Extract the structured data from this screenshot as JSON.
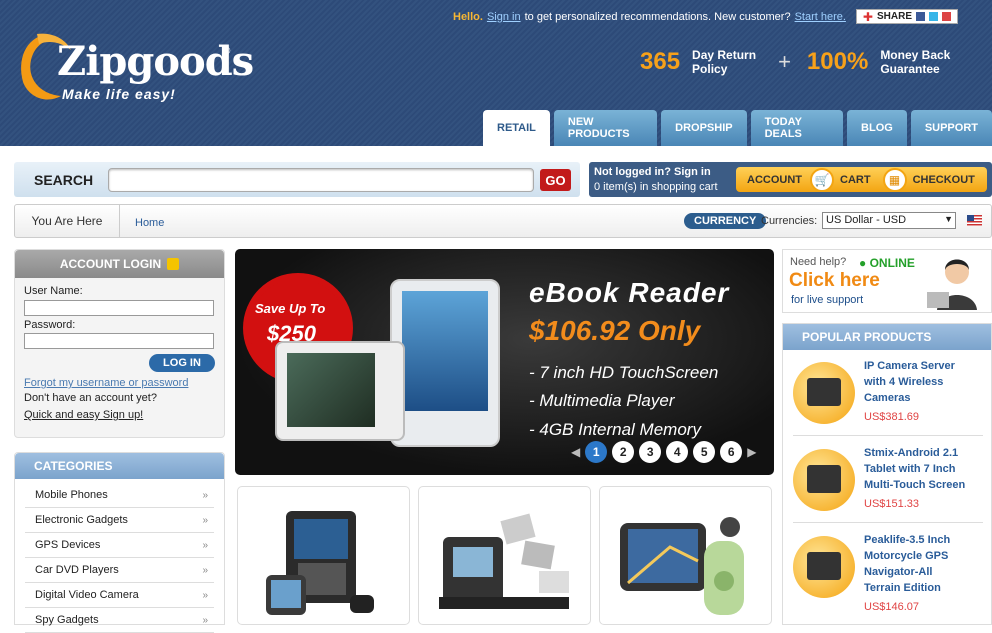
{
  "topbar": {
    "hello": "Hello.",
    "signin": "Sign in",
    "text": "to get personalized recommendations. New customer?",
    "start": "Start here.",
    "share": "SHARE"
  },
  "logo": {
    "name": "Zipgoods",
    "reg": "®",
    "tagline": "Make life easy!"
  },
  "promo": {
    "days": "365",
    "days_text_1": "Day Return",
    "days_text_2": "Policy",
    "plus": "+",
    "pct": "100%",
    "pct_text_1": "Money Back",
    "pct_text_2": "Guarantee"
  },
  "tabs": [
    "RETAIL",
    "NEW PRODUCTS",
    "DROPSHIP",
    "TODAY DEALS",
    "BLOG",
    "SUPPORT"
  ],
  "search": {
    "label": "SEARCH",
    "value": "",
    "go": "GO"
  },
  "account": {
    "status": "Not logged in? Sign in",
    "cart_count": "0 item(s) in shopping cart",
    "account": "ACCOUNT",
    "cart": "CART",
    "checkout": "CHECKOUT"
  },
  "breadcrumb": {
    "you_are_here": "You Are Here",
    "home": "Home",
    "currency_badge": "CURRENCY",
    "currency_label": "Currencies:",
    "currency_value": "US Dollar - USD"
  },
  "login": {
    "title": "ACCOUNT LOGIN",
    "username_label": "User Name:",
    "password_label": "Password:",
    "button": "LOG IN",
    "forgot": "Forgot my username or password",
    "no_account": "Don't have an account yet?",
    "signup": "Quick and easy Sign up!"
  },
  "categories": {
    "title": "CATEGORIES",
    "items": [
      "Mobile Phones",
      "Electronic Gadgets",
      "GPS Devices",
      "Car DVD Players",
      "Digital Video Camera",
      "Spy Gadgets"
    ]
  },
  "banner": {
    "save_line1": "Save Up To",
    "save_line2": "$250",
    "title": "eBook Reader",
    "price": "$106.92 Only",
    "features": [
      "- 7 inch HD TouchScreen",
      "- Multimedia Player",
      "- 4GB Internal Memory"
    ],
    "pages": [
      "1",
      "2",
      "3",
      "4",
      "5",
      "6"
    ],
    "active_page": "1"
  },
  "help": {
    "need": "Need help?",
    "online": "ONLINE",
    "click": "Click here",
    "for_live": "for live support"
  },
  "popular": {
    "title": "POPULAR PRODUCTS",
    "items": [
      {
        "name_1": "IP Camera Server",
        "name_2": "with 4 Wireless",
        "name_3": "Cameras",
        "name_4": "",
        "price": "US$381.69"
      },
      {
        "name_1": "Stmix-Android 2.1",
        "name_2": "Tablet with 7 Inch",
        "name_3": "Multi-Touch Screen",
        "name_4": "",
        "price": "US$151.33"
      },
      {
        "name_1": "Peaklife-3.5 Inch",
        "name_2": "Motorcycle GPS",
        "name_3": "Navigator-All",
        "name_4": "Terrain Edition",
        "price": "US$146.07"
      }
    ]
  },
  "colors": {
    "header_bg": "#2d4a78",
    "accent_orange": "#f7a11a",
    "go_red": "#c21a1a",
    "link_blue": "#2a5c99",
    "price_red": "#e04444"
  }
}
